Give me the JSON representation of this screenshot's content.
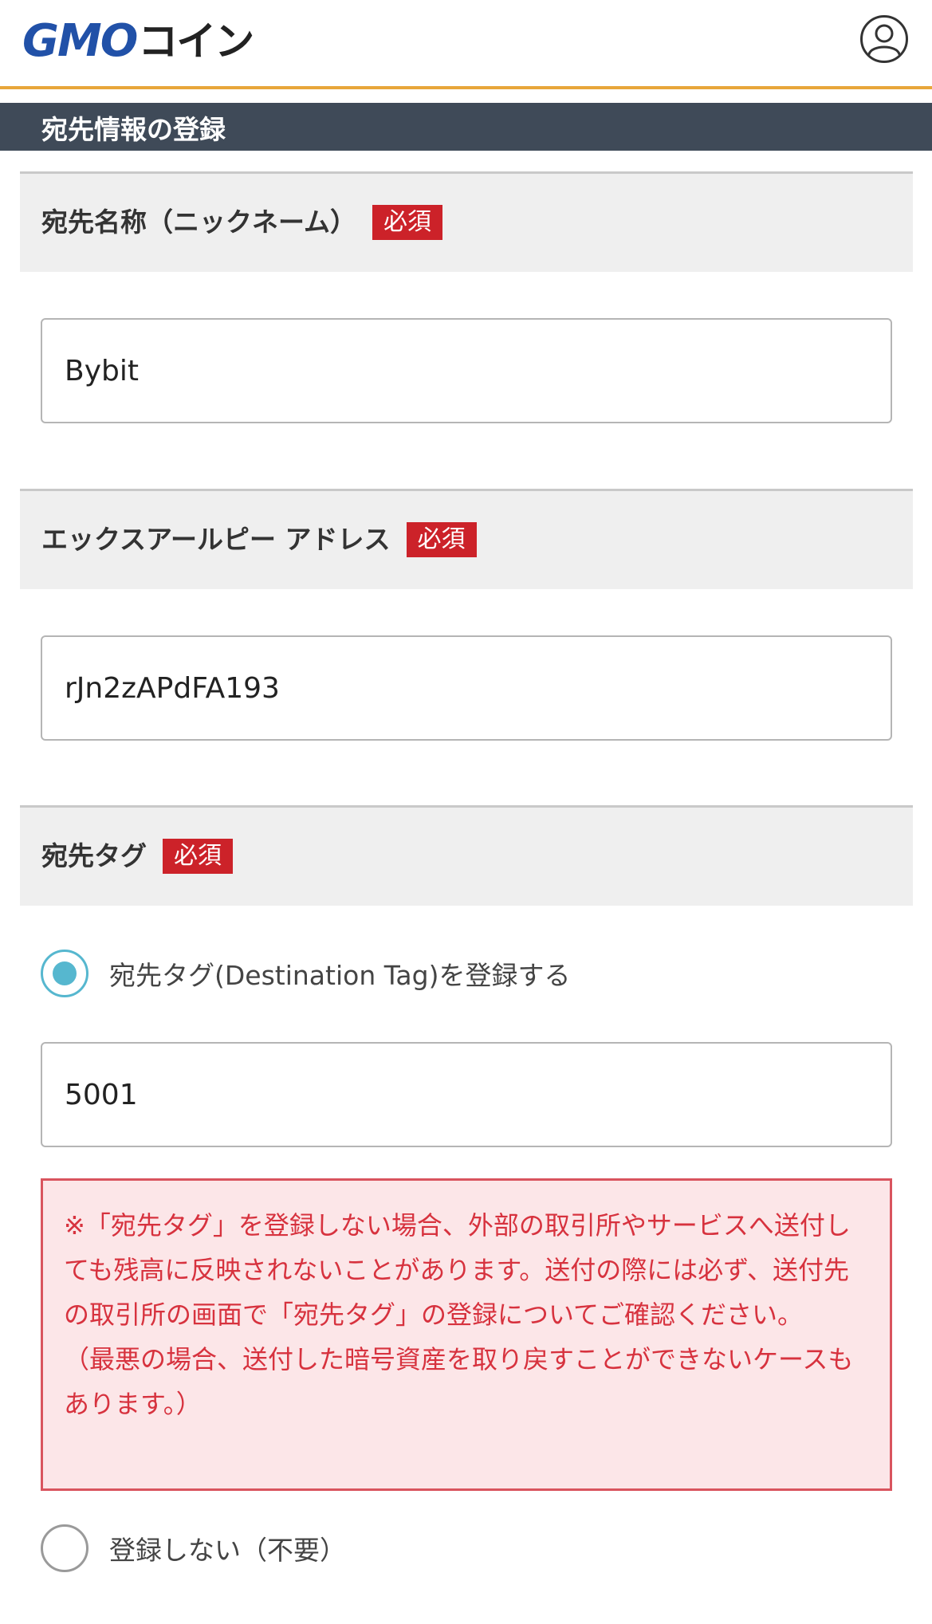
{
  "header": {
    "logo_primary": "GMO",
    "logo_secondary": "コイン",
    "account_icon": "user-circle-icon",
    "accent_color": "#e8a63a"
  },
  "title_bar": {
    "title": "宛先情報の登録",
    "background_color": "#3f4a58"
  },
  "sections": {
    "nickname": {
      "label": "宛先名称（ニックネーム）",
      "badge": "必須",
      "value": "Bybit"
    },
    "address": {
      "label": "エックスアールピー アドレス",
      "badge": "必須",
      "value": "rJn2zAPdFA193"
    },
    "tag": {
      "label": "宛先タグ",
      "badge": "必須",
      "option_register": "宛先タグ(Destination Tag)を登録する",
      "option_register_checked": true,
      "value": "5001",
      "warning_main": "※「宛先タグ」を登録しない場合、外部の取引所やサービスへ送付しても残高に反映されないことがあります。送付の際には必ず、送付先の取引所の画面で「宛先タグ」の登録についてご確認ください。",
      "warning_note": "（最悪の場合、送付した暗号資産を取り戻すことができないケースもあります。）",
      "option_none": "登録しない（不要）",
      "option_none_checked": false
    }
  },
  "colors": {
    "required_badge": "#cc2229",
    "radio_selected": "#56b7cf",
    "warning_text": "#d7323e",
    "warning_background": "#fce6e8"
  }
}
